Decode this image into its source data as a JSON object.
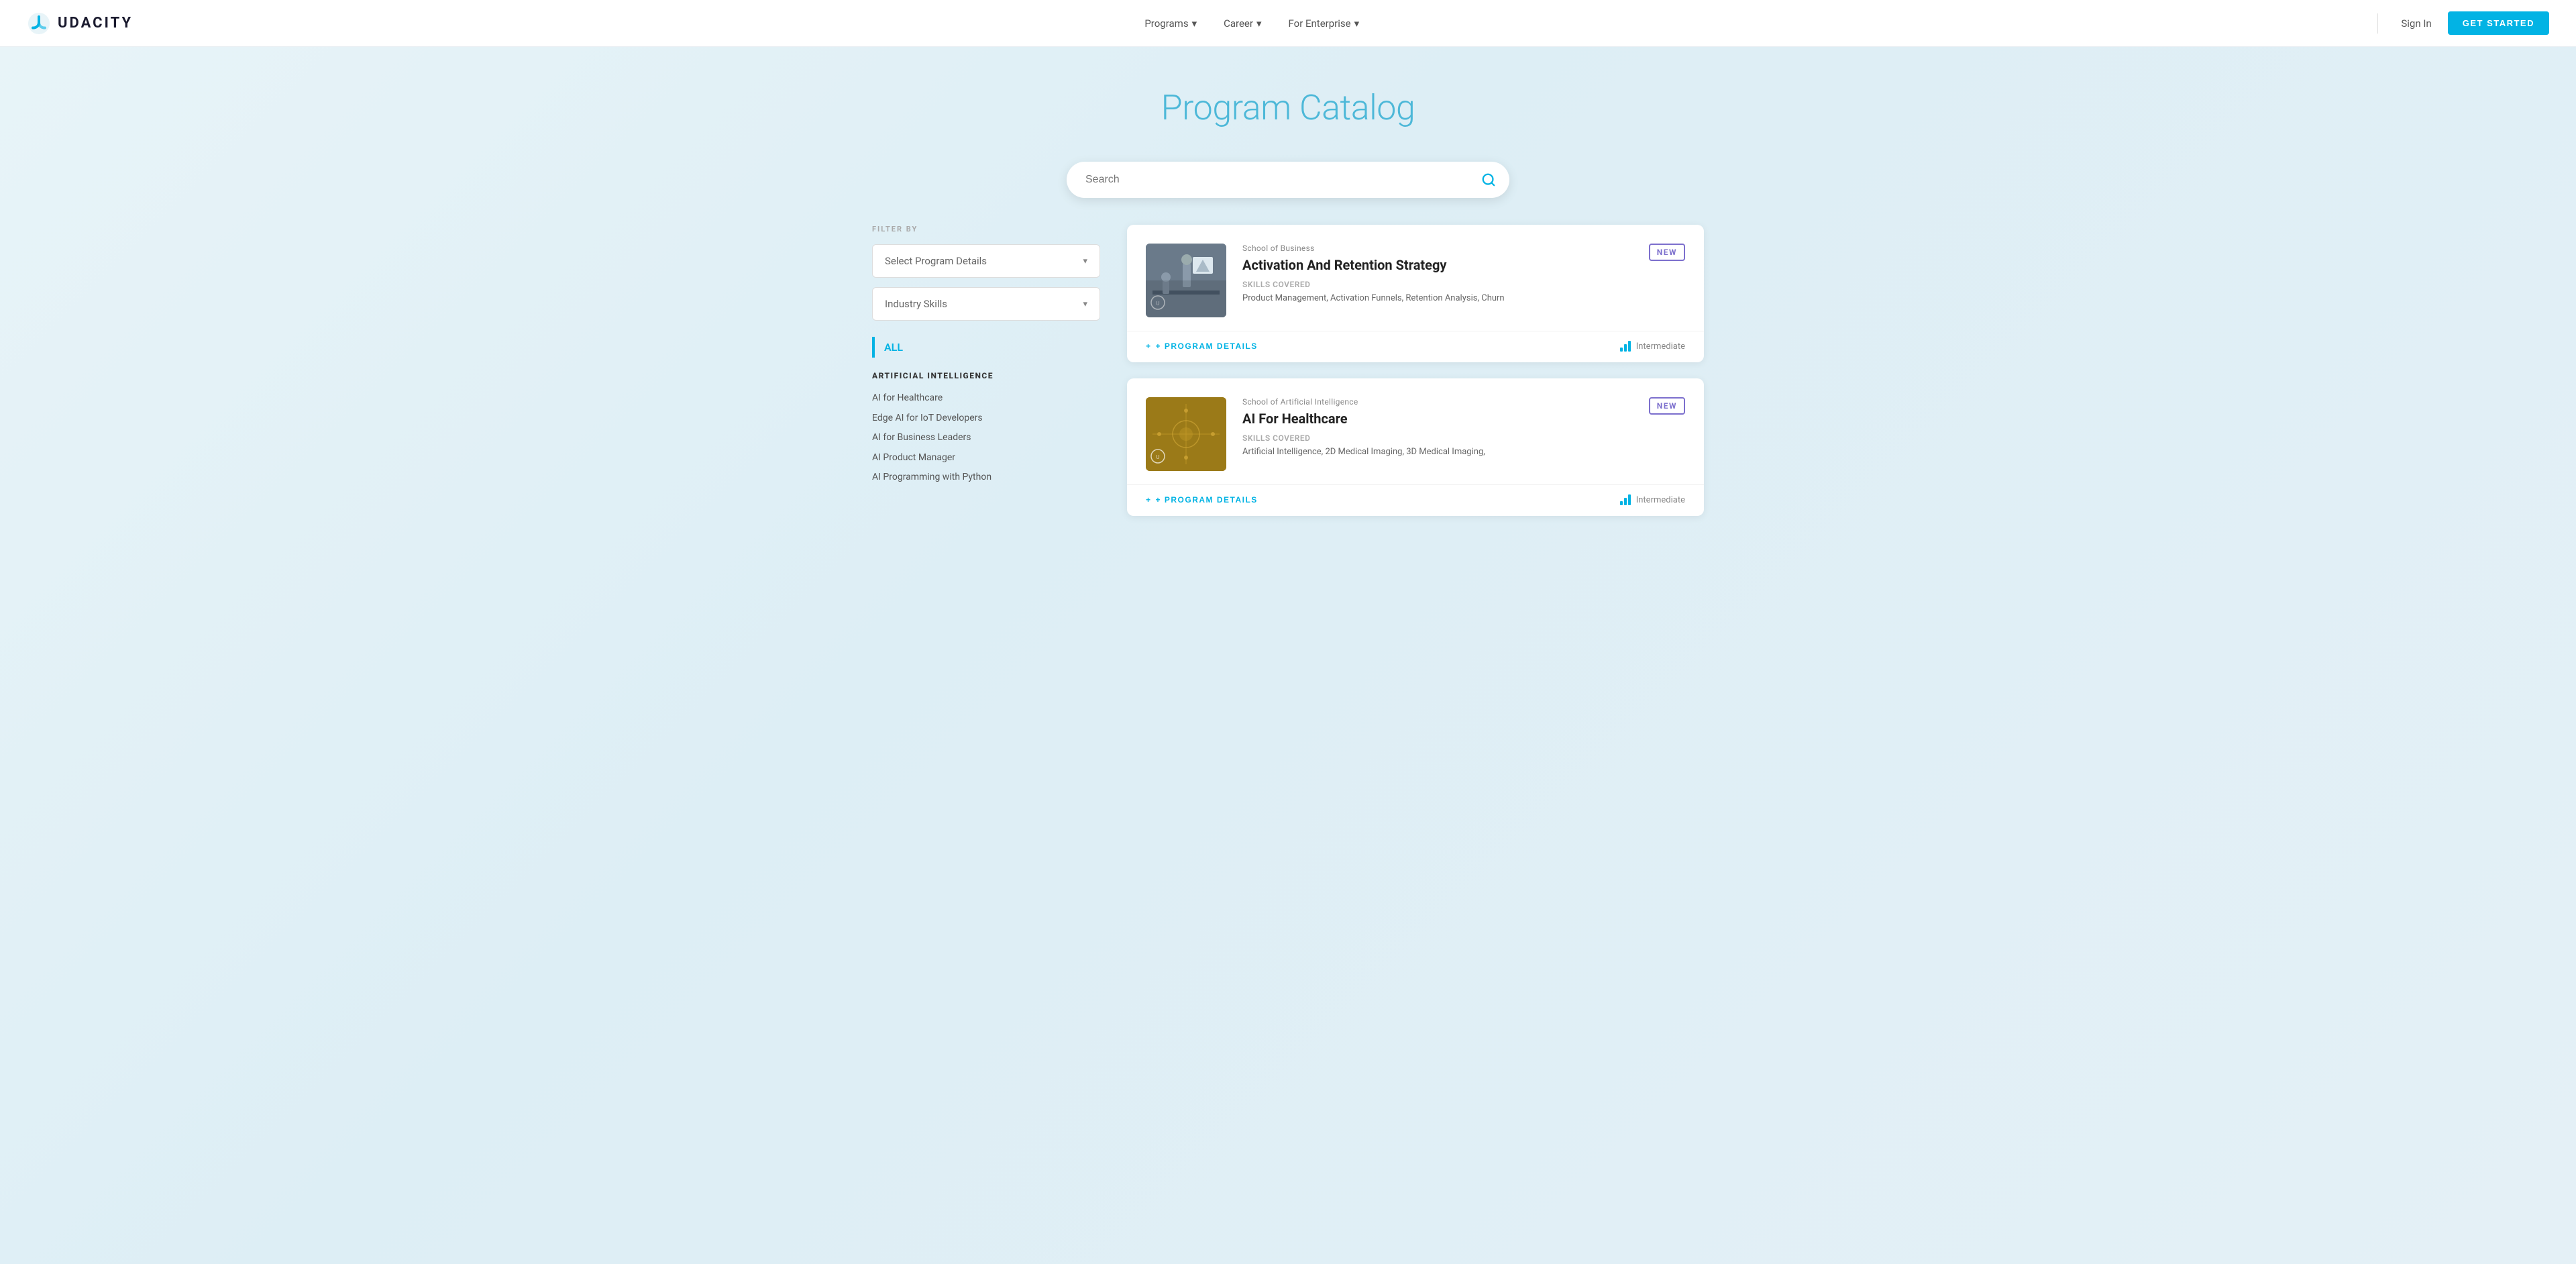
{
  "nav": {
    "logo_text": "UDACITY",
    "items": [
      {
        "label": "Programs",
        "has_dropdown": true
      },
      {
        "label": "Career",
        "has_dropdown": true
      },
      {
        "label": "For Enterprise",
        "has_dropdown": true
      }
    ],
    "sign_in": "Sign In",
    "get_started": "GET STARTED"
  },
  "hero": {
    "title": "Program Catalog"
  },
  "search": {
    "placeholder": "Search"
  },
  "sidebar": {
    "filter_label": "FILTER BY",
    "filter1": "Select Program Details",
    "filter2": "Industry Skills",
    "all_label": "ALL",
    "categories": [
      {
        "title": "ARTIFICIAL INTELLIGENCE",
        "items": [
          "AI for Healthcare",
          "Edge AI for IoT Developers",
          "AI for Business Leaders",
          "AI Product Manager",
          "AI Programming with Python"
        ]
      }
    ]
  },
  "programs": [
    {
      "school": "School of Business",
      "title": "Activation And Retention Strategy",
      "skills_label": "Skills Covered",
      "skills": "Product Management, Activation Funnels, Retention Analysis, Churn",
      "badge": "NEW",
      "level": "Intermediate",
      "thumb_type": "business"
    },
    {
      "school": "School of Artificial Intelligence",
      "title": "AI For Healthcare",
      "skills_label": "Skills Covered",
      "skills": "Artificial Intelligence, 2D Medical Imaging, 3D Medical Imaging,",
      "badge": "NEW",
      "level": "Intermediate",
      "thumb_type": "ai"
    }
  ],
  "footer_btn_label": "+ PROGRAM DETAILS"
}
